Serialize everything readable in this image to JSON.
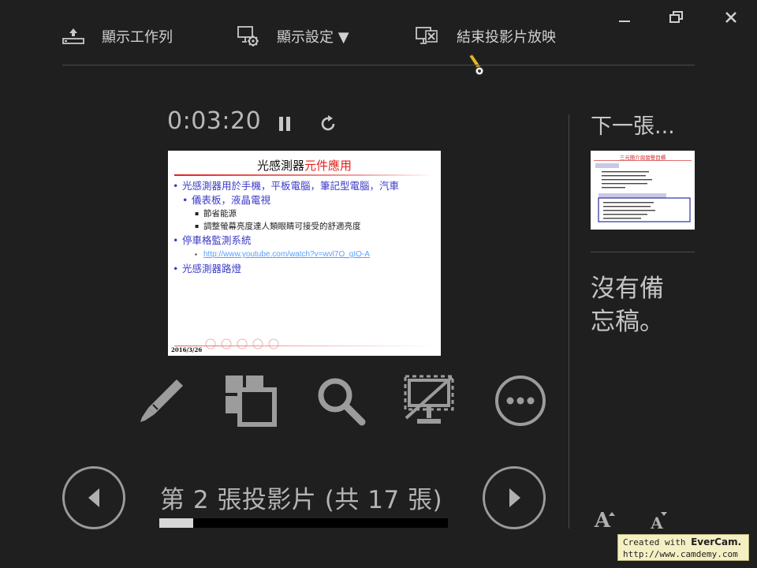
{
  "toolbar": {
    "show_taskbar": "顯示工作列",
    "display_settings": "顯示設定 ▼",
    "end_slideshow": "結束投影片放映"
  },
  "timer": {
    "elapsed": "0:03:20"
  },
  "current_slide": {
    "title_black": "光感測器",
    "title_red": "元件應用",
    "bullets": [
      {
        "level": 1,
        "text": "光感測器用於手機，平板電腦，筆記型電腦，汽車"
      },
      {
        "level": 1,
        "text": "儀表板，液晶電視"
      },
      {
        "level": 2,
        "text": "節省能源"
      },
      {
        "level": 2,
        "text": "調整螢幕亮度達人類眼睛可接受的舒適亮度"
      },
      {
        "level": 1,
        "text": "停車格監測系統"
      },
      {
        "level": 2,
        "text": "http://www.youtube.com/watch?v=wvl7O_gIO-A"
      },
      {
        "level": 1,
        "text": "光感測器路燈"
      }
    ],
    "date": "2016/3/26"
  },
  "navigation": {
    "slide_counter": "第 2 張投影片 (共 17 張)",
    "progress_fraction": 0.118
  },
  "next_panel": {
    "label": "下一張...",
    "thumb_title": "三元簡介與發警目標",
    "notes_line1": "沒有備",
    "notes_line2": "忘稿。"
  },
  "font_controls": {
    "increase": "A",
    "decrease": "A"
  },
  "watermark": {
    "line1_prefix": "Created with ",
    "line1_brand": "EverCam.",
    "line2": "http://www.camdemy.com"
  },
  "icons": {
    "taskbar": "taskbar-icon",
    "display_settings": "monitor-gear-icon",
    "end_show": "monitor-close-icon",
    "pause": "pause-icon",
    "restart": "restart-icon",
    "pen": "pen-icon",
    "see_all": "see-all-slides-icon",
    "zoom": "zoom-icon",
    "black_screen": "black-screen-icon",
    "more": "more-options-icon",
    "prev": "previous-slide-icon",
    "next": "next-slide-icon",
    "minimize": "minimize-icon",
    "restore": "restore-icon",
    "close": "close-icon"
  },
  "colors": {
    "background": "#1f1f1f",
    "title_red": "#e0201a",
    "bullet_blue": "#3a3ac8"
  }
}
